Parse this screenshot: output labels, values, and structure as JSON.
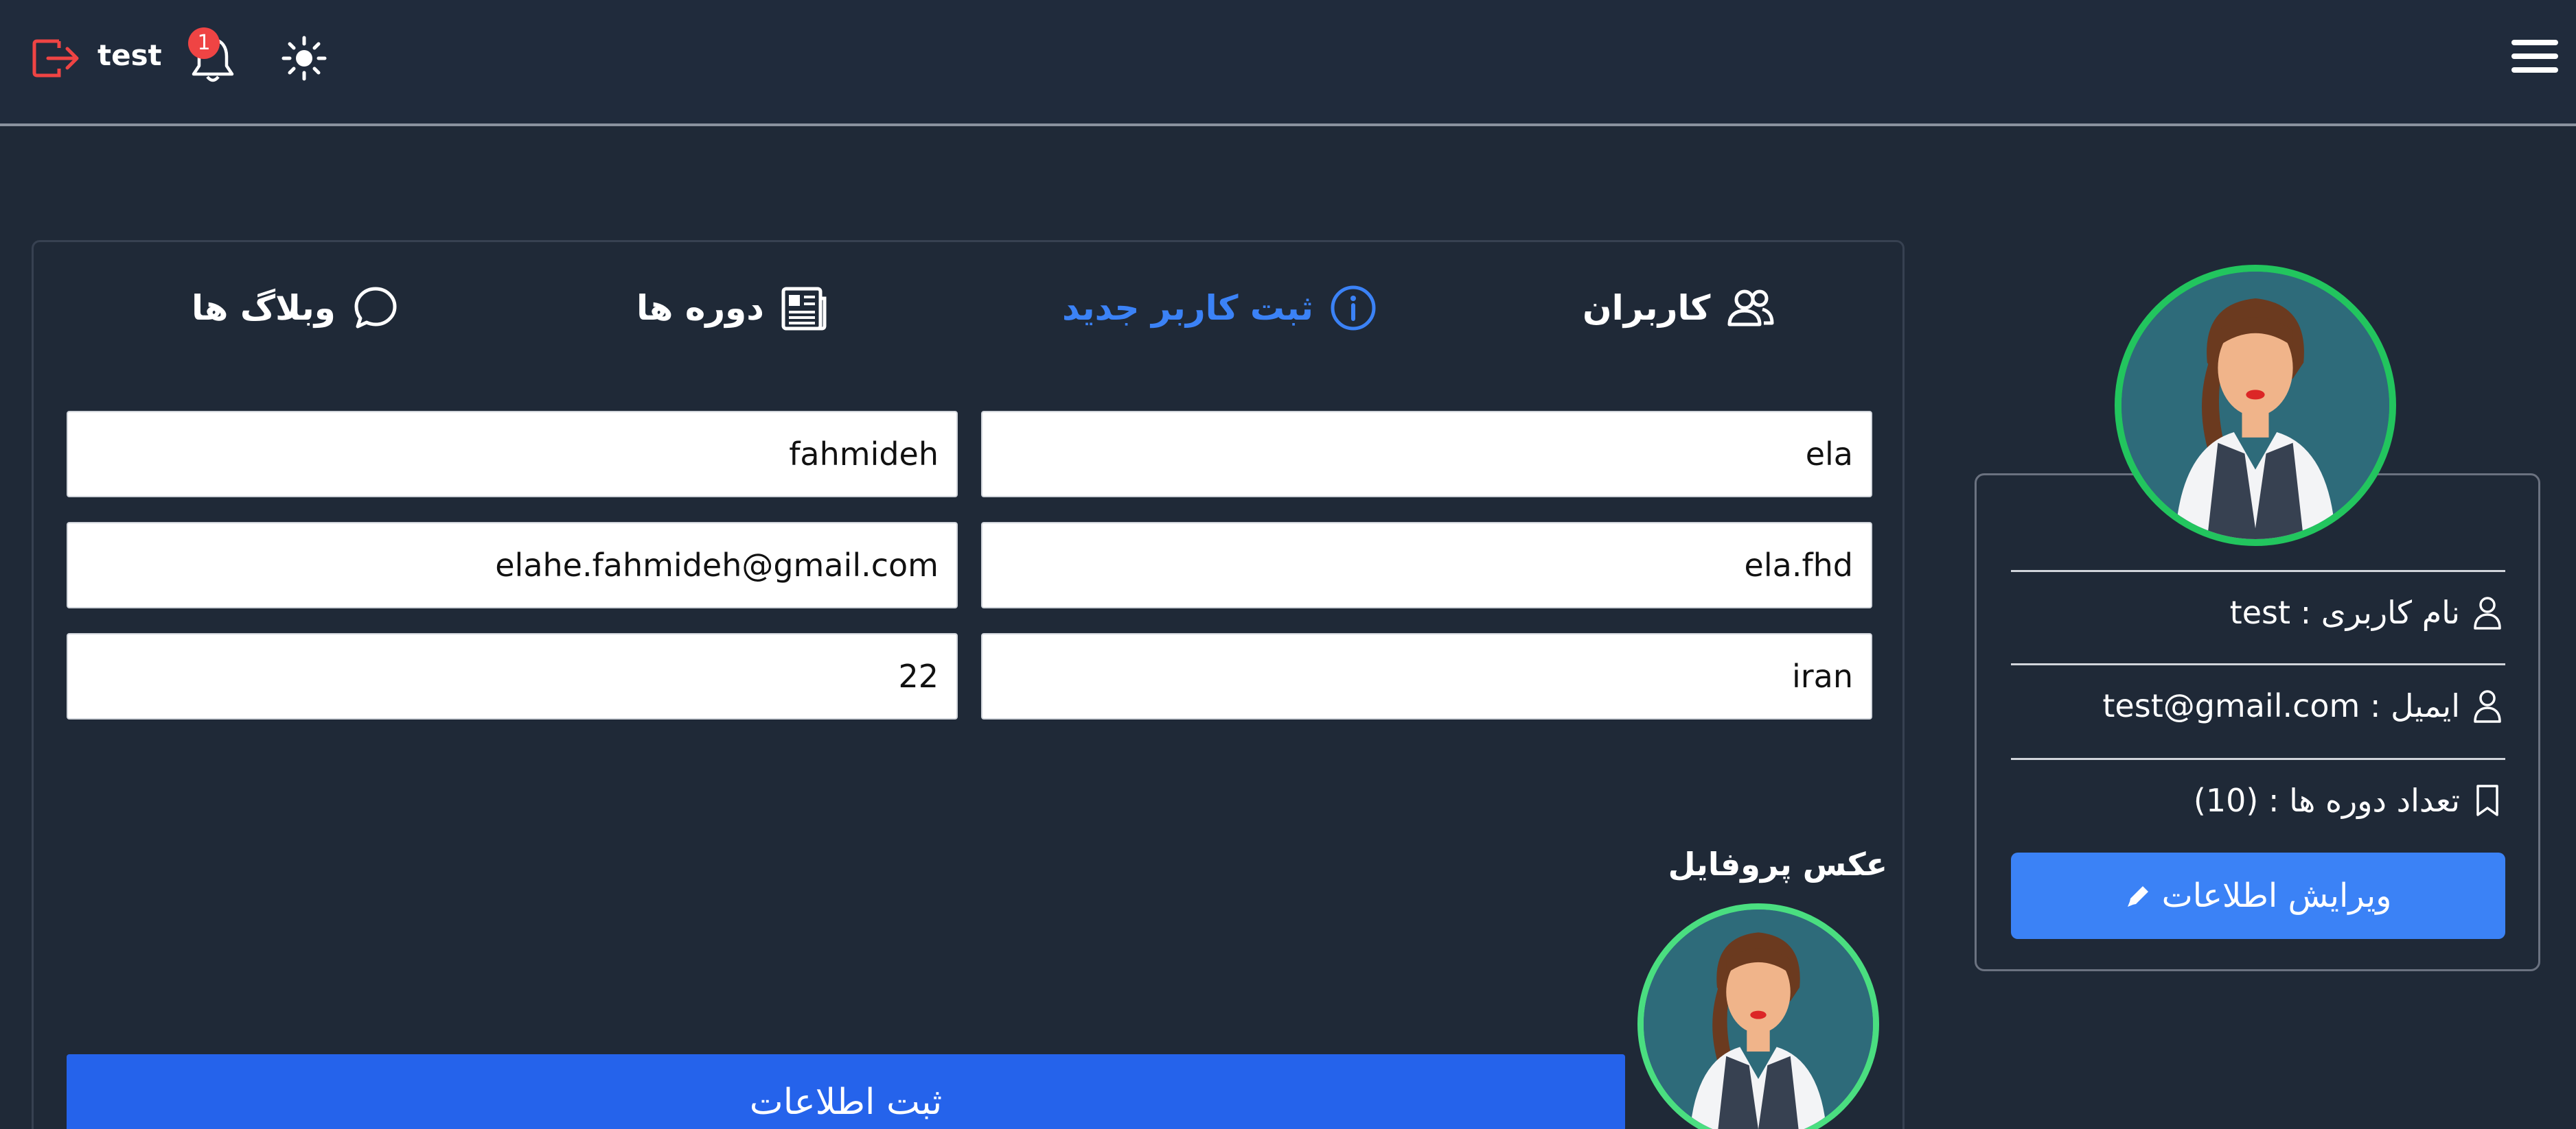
{
  "header": {
    "username": "test",
    "notification_count": "1",
    "icons": [
      "logout-icon",
      "bell-icon",
      "sun-icon",
      "hamburger-menu-icon"
    ]
  },
  "tabs": [
    {
      "label": "وبلاگ ها",
      "icon": "chat-bubble-icon",
      "active": false
    },
    {
      "label": "دوره ها",
      "icon": "newspaper-icon",
      "active": false
    },
    {
      "label": "ثبت کاربر جدید",
      "icon": "info-circle-icon",
      "active": true
    },
    {
      "label": "کاربران",
      "icon": "users-icon",
      "active": false
    }
  ],
  "form": {
    "first_name": "ela",
    "last_name": "fahmideh",
    "username": "ela.fhd",
    "email": "elahe.fahmideh@gmail.com",
    "city": "iran",
    "age": "22",
    "profile_photo_label": "عکس پروفایل",
    "submit_label": "ثبت اطلاعات"
  },
  "profile": {
    "username_line": "نام کاربری : test",
    "email_line": "ایمیل : test@gmail.com",
    "courses_line": "تعداد دوره ها : (10)",
    "edit_label": "ویرایش اطلاعات"
  },
  "colors": {
    "background": "#1f2937",
    "accent": "#3b82f6",
    "button": "#2563eb",
    "avatar_ring": "#22c55e",
    "badge": "#ef4444",
    "logout": "#ef4444"
  }
}
